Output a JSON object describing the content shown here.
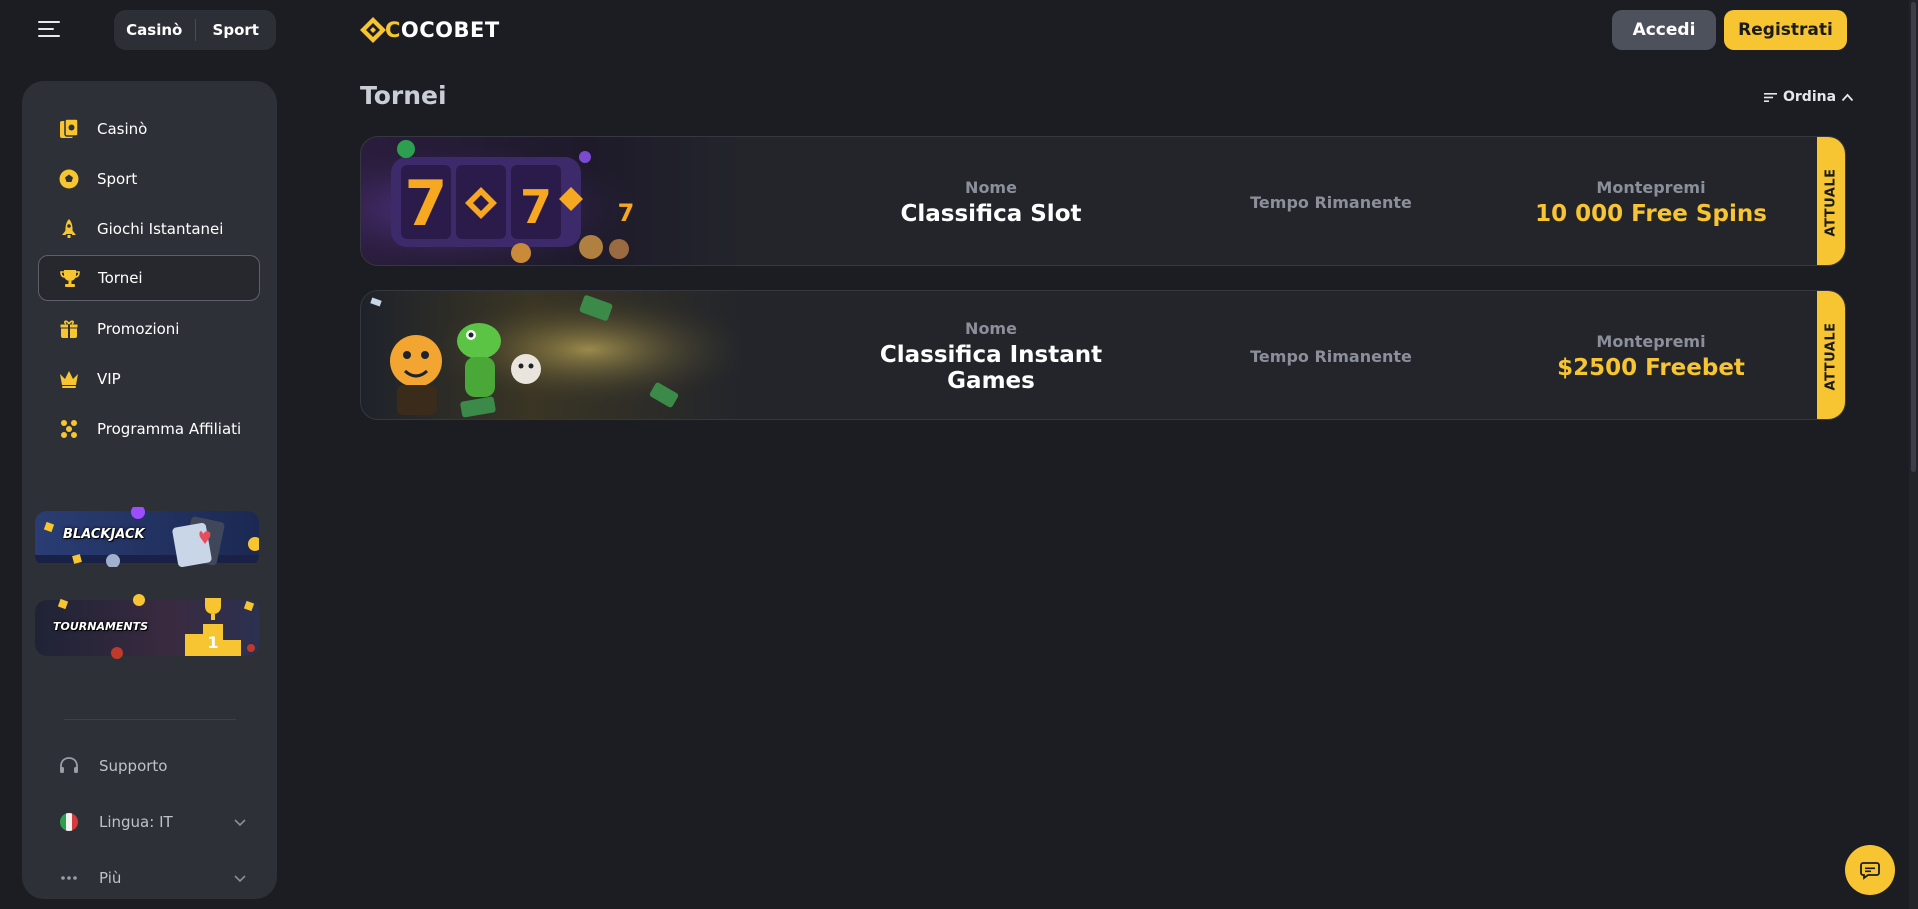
{
  "header": {
    "mode_tabs": [
      "Casinò",
      "Sport"
    ],
    "logo_text_a": "C",
    "logo_text_b": "OCOBET",
    "login_label": "Accedi",
    "register_label": "Registrati"
  },
  "sidebar": {
    "items": [
      {
        "label": "Casinò",
        "icon": "casino-cards-icon"
      },
      {
        "label": "Sport",
        "icon": "soccer-ball-icon"
      },
      {
        "label": "Giochi Istantanei",
        "icon": "rocket-icon"
      },
      {
        "label": "Tornei",
        "icon": "trophy-icon",
        "active": true
      },
      {
        "label": "Promozioni",
        "icon": "gift-icon"
      },
      {
        "label": "VIP",
        "icon": "crown-icon"
      },
      {
        "label": "Programma Affiliati",
        "icon": "affiliates-icon"
      }
    ],
    "banners": [
      {
        "text": "BLACKJACK"
      },
      {
        "text": "TOURNAMENTS"
      }
    ],
    "footer": {
      "support_label": "Supporto",
      "language_label": "Lingua: IT",
      "more_label": "Più"
    }
  },
  "main": {
    "title": "Tornei",
    "sort_label": "Ordina",
    "tournaments": [
      {
        "name_label": "Nome",
        "name": "Classifica Slot",
        "time_label": "Tempo Rimanente",
        "prize_label": "Montepremi",
        "prize": "10 000 Free Spins",
        "status": "ATTUALE"
      },
      {
        "name_label": "Nome",
        "name": "Classifica Instant Games",
        "time_label": "Tempo Rimanente",
        "prize_label": "Montepremi",
        "prize": "$2500 Freebet",
        "status": "ATTUALE"
      }
    ]
  },
  "colors": {
    "accent": "#f7c531",
    "background": "#1c1d22",
    "sidebar": "#2d3037",
    "card": "#23252b"
  }
}
